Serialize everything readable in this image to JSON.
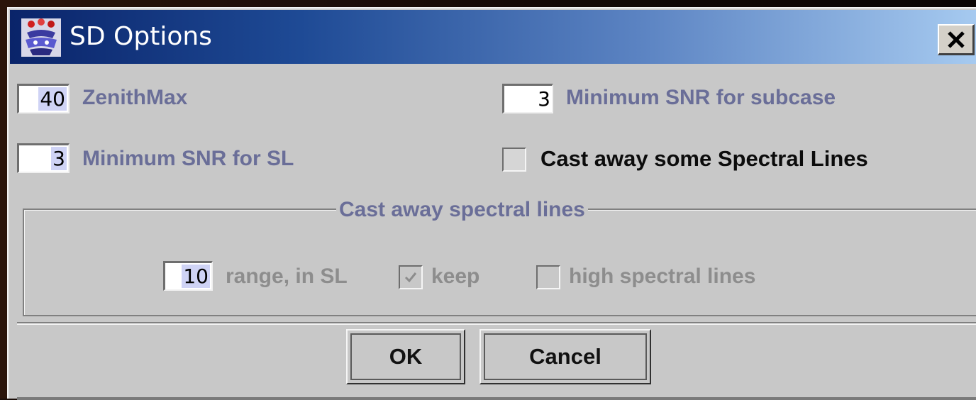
{
  "window": {
    "title": "SD Options",
    "app_icon": "flower-vase-icon",
    "close_icon": "close-icon"
  },
  "fields": {
    "zenith_max": {
      "value": "40",
      "label": "ZenithMax"
    },
    "min_snr_subcase": {
      "value": "3",
      "label": "Minimum SNR for subcase"
    },
    "min_snr_sl": {
      "value": "3",
      "label": "Minimum SNR for SL"
    },
    "cast_away": {
      "label": "Cast away some Spectral Lines",
      "checked": false
    }
  },
  "group": {
    "title": "Cast away spectral lines",
    "range_value": "10",
    "range_label": "range, in SL",
    "keep_label": "keep",
    "keep_checked": true,
    "high_label": "high spectral lines",
    "high_checked": false
  },
  "buttons": {
    "ok": "OK",
    "cancel": "Cancel"
  },
  "colors": {
    "title_gradient_start": "#0a246a",
    "title_gradient_end": "#a6caf0",
    "label_enabled": "#6a6e98",
    "label_disabled": "#8d8d8d",
    "dialog_bg": "#c8c8c8"
  }
}
